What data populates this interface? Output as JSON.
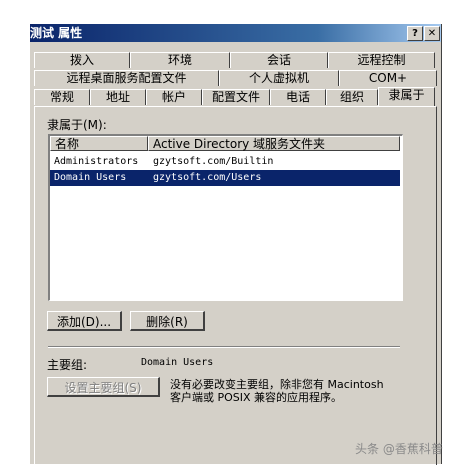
{
  "window": {
    "title": "测试 属性",
    "help_label": "?",
    "close_label": "✕"
  },
  "tabs": {
    "row1": [
      "拨入",
      "环境",
      "会话",
      "远程控制"
    ],
    "row2": [
      "远程桌面服务配置文件",
      "个人虚拟机",
      "COM+"
    ],
    "row3": [
      "常规",
      "地址",
      "帐户",
      "配置文件",
      "电话",
      "组织",
      "隶属于"
    ],
    "active": "隶属于"
  },
  "member_of": {
    "label": "隶属于(M):",
    "columns": [
      "名称",
      "Active Directory 域服务文件夹"
    ],
    "rows": [
      {
        "name": "Administrators",
        "folder": "gzytsoft.com/Builtin",
        "selected": false
      },
      {
        "name": "Domain Users",
        "folder": "gzytsoft.com/Users",
        "selected": true
      }
    ]
  },
  "buttons": {
    "add": "添加(D)...",
    "remove": "删除(R)",
    "set_primary": "设置主要组(S)"
  },
  "primary_group": {
    "label": "主要组:",
    "value": "Domain Users",
    "note_line1": "没有必要改变主要组，除非您有 Macintosh",
    "note_line2": "客户端或 POSIX 兼容的应用程序。"
  },
  "watermark": "头条 @香蕉科普",
  "colors": {
    "face": "#d4d0c8",
    "selection": "#0a246a",
    "titlebar": "#0a246a"
  }
}
